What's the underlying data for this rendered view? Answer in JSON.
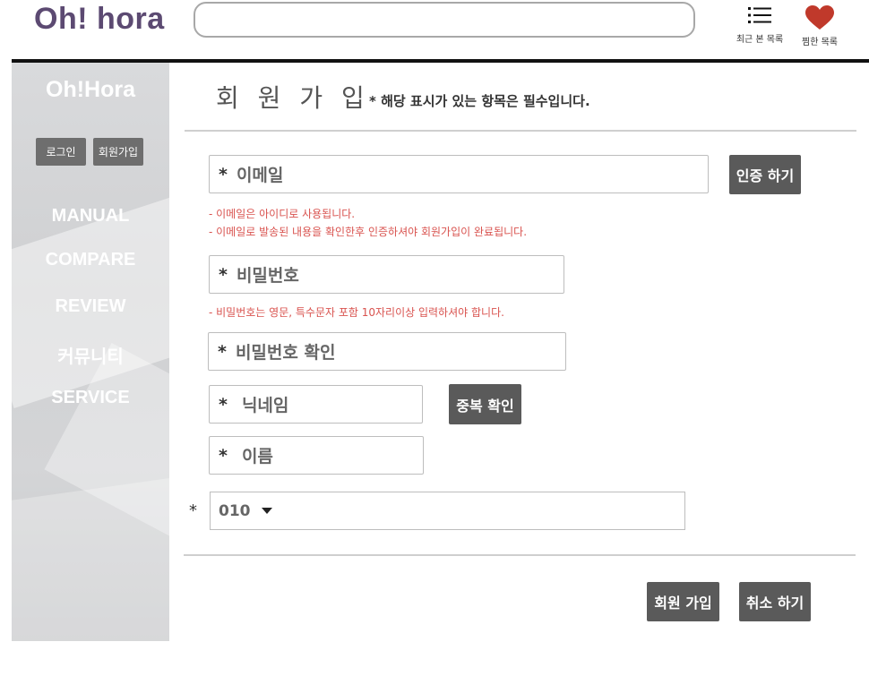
{
  "header": {
    "logo": "Oh! hora",
    "search_placeholder": "",
    "recent_label": "최근 본 목록",
    "recent_icon": "list-icon",
    "fav_label": "찜한 목록",
    "fav_icon": "heart-icon",
    "fav_color": "#c0392b"
  },
  "sidebar": {
    "logo": "Oh!Hora",
    "login": "로그인",
    "join": "회원가입",
    "menu": [
      "MANUAL",
      "COMPARE",
      "REVIEW",
      "커뮤니티",
      "SERVICE"
    ]
  },
  "form": {
    "title": "회 원 가 입",
    "required_note": "* 해당 표시가 있는 항목은 필수입니다.",
    "email": {
      "star": "*",
      "placeholder": "이메일"
    },
    "verify_button": "인증 하기",
    "email_hint_1": "- 이메일은 아이디로 사용됩니다.",
    "email_hint_2": "- 이메일로 발송된 내용을 확인한후 인증하셔야 회원가입이 완료됩니다.",
    "password": {
      "star": "*",
      "placeholder": "비밀번호"
    },
    "password_hint": "- 비밀번호는 영문, 특수문자 포함 10자리이상 입력하셔야 합니다.",
    "password_confirm": {
      "star": "*",
      "placeholder": "비밀번호 확인"
    },
    "nickname": {
      "star": "*",
      "placeholder": "닉네임"
    },
    "dup_button": "중복 확인",
    "name": {
      "star": "*",
      "placeholder": "이름"
    },
    "phone": {
      "star": "*",
      "prefix": "010",
      "value": ""
    },
    "submit_button": "회원 가입",
    "cancel_button": "취소 하기"
  },
  "colors": {
    "logo": "#5c4a72",
    "button": "#5a5a5a",
    "hint": "#d9534f"
  }
}
